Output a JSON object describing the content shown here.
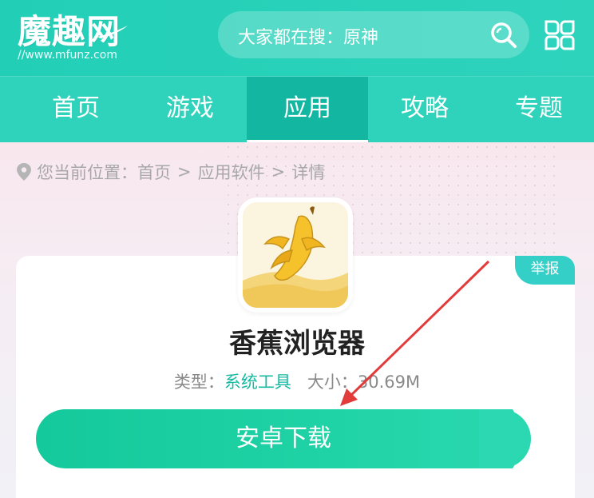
{
  "header": {
    "logo_text": "魔趣网",
    "logo_url": "//www.mfunz.com",
    "search_placeholder": "大家都在搜：原神"
  },
  "nav": {
    "items": [
      {
        "label": "首页"
      },
      {
        "label": "游戏"
      },
      {
        "label": "应用"
      },
      {
        "label": "攻略"
      },
      {
        "label": "专题"
      }
    ],
    "active_index": 2
  },
  "breadcrumb": {
    "prefix": "您当前位置：",
    "items": [
      "首页",
      "应用软件",
      "详情"
    ],
    "separator": ">"
  },
  "app": {
    "name": "香蕉浏览器",
    "type_label": "类型：",
    "type_value": "系统工具",
    "size_label": "大小：",
    "size_value": "30.69M",
    "report_label": "举报",
    "download_label": "安卓下载"
  },
  "colors": {
    "brand": "#2fd2bb",
    "nav_active": "#12b6a1",
    "download_button": "#14c99b",
    "arrow": "#e23b3b"
  },
  "icons": {
    "search": "search-icon",
    "menu": "grid-menu-icon",
    "location": "location-pin-icon",
    "app": "banana-icon"
  }
}
